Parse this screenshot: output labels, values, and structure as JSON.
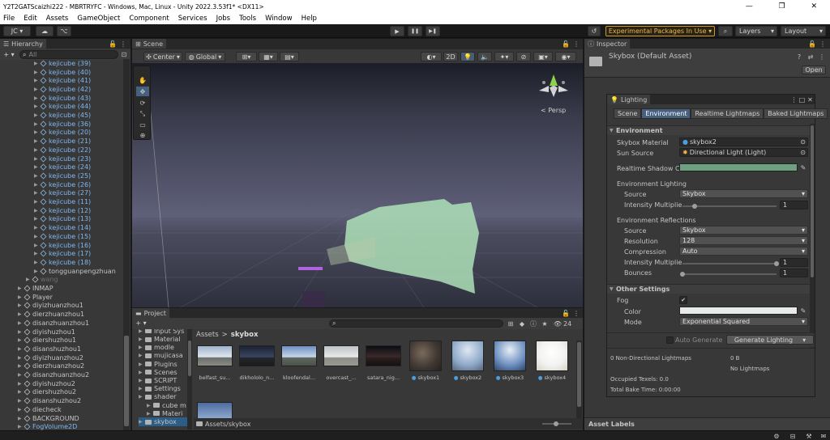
{
  "window": {
    "title": "Y2T2GATScaizhi222 - MBRTRYFC - Windows, Mac, Linux - Unity 2022.3.53f1* <DX11>",
    "minimize": "—",
    "maximize": "❐",
    "close": "✕"
  },
  "menu": [
    "File",
    "Edit",
    "Assets",
    "GameObject",
    "Component",
    "Services",
    "Jobs",
    "Tools",
    "Window",
    "Help"
  ],
  "toolbar": {
    "account": "JC ▾",
    "play": "▶",
    "pause": "❚❚",
    "step": "▶❚",
    "experimental": "Experimental Packages In Use ▾",
    "layers": "Layers",
    "layout": "Layout"
  },
  "hierarchy": {
    "tab": "Hierarchy",
    "search_placeholder": "All",
    "items": [
      {
        "label": "kejicube (39)",
        "indent": 52,
        "blue": true
      },
      {
        "label": "kejicube (40)",
        "indent": 52,
        "blue": true
      },
      {
        "label": "kejicube (41)",
        "indent": 52,
        "blue": true
      },
      {
        "label": "kejicube (42)",
        "indent": 52,
        "blue": true
      },
      {
        "label": "kejicube (43)",
        "indent": 52,
        "blue": true
      },
      {
        "label": "kejicube (44)",
        "indent": 52,
        "blue": true
      },
      {
        "label": "kejicube (45)",
        "indent": 52,
        "blue": true
      },
      {
        "label": "kejicube (36)",
        "indent": 52,
        "blue": true
      },
      {
        "label": "kejicube (20)",
        "indent": 52,
        "blue": true
      },
      {
        "label": "kejicube (21)",
        "indent": 52,
        "blue": true
      },
      {
        "label": "kejicube (22)",
        "indent": 52,
        "blue": true
      },
      {
        "label": "kejicube (23)",
        "indent": 52,
        "blue": true
      },
      {
        "label": "kejicube (24)",
        "indent": 52,
        "blue": true
      },
      {
        "label": "kejicube (25)",
        "indent": 52,
        "blue": true
      },
      {
        "label": "kejicube (26)",
        "indent": 52,
        "blue": true
      },
      {
        "label": "kejicube (27)",
        "indent": 52,
        "blue": true
      },
      {
        "label": "kejicube (11)",
        "indent": 52,
        "blue": true
      },
      {
        "label": "kejicube (12)",
        "indent": 52,
        "blue": true
      },
      {
        "label": "kejicube (13)",
        "indent": 52,
        "blue": true
      },
      {
        "label": "kejicube (14)",
        "indent": 52,
        "blue": true
      },
      {
        "label": "kejicube (15)",
        "indent": 52,
        "blue": true
      },
      {
        "label": "kejicube (16)",
        "indent": 52,
        "blue": true
      },
      {
        "label": "kejicube (17)",
        "indent": 52,
        "blue": true
      },
      {
        "label": "kejicube (18)",
        "indent": 52,
        "blue": true
      },
      {
        "label": "tongguanpengzhuan",
        "indent": 52,
        "blue": false
      },
      {
        "label": "wang",
        "indent": 42,
        "blue": false,
        "dim": true
      },
      {
        "label": "INMAP",
        "indent": 32,
        "blue": false
      },
      {
        "label": "Player",
        "indent": 32,
        "blue": false
      },
      {
        "label": "diyizhuanzhou1",
        "indent": 32,
        "blue": false
      },
      {
        "label": "dierzhuanzhou1",
        "indent": 32,
        "blue": false
      },
      {
        "label": "disanzhuanzhou1",
        "indent": 32,
        "blue": false
      },
      {
        "label": "diyishuzhou1",
        "indent": 32,
        "blue": false
      },
      {
        "label": "diershuzhou1",
        "indent": 32,
        "blue": false
      },
      {
        "label": "disanshuzhou1",
        "indent": 32,
        "blue": false
      },
      {
        "label": "diyizhuanzhou2",
        "indent": 32,
        "blue": false
      },
      {
        "label": "dierzhuanzhou2",
        "indent": 32,
        "blue": false
      },
      {
        "label": "disanzhuanzhou2",
        "indent": 32,
        "blue": false
      },
      {
        "label": "diyishuzhou2",
        "indent": 32,
        "blue": false
      },
      {
        "label": "diershuzhou2",
        "indent": 32,
        "blue": false
      },
      {
        "label": "disanshuzhou2",
        "indent": 32,
        "blue": false
      },
      {
        "label": "diecheck",
        "indent": 32,
        "blue": false
      },
      {
        "label": "BACKGROUND",
        "indent": 32,
        "blue": false
      },
      {
        "label": "FogVolume2D",
        "indent": 32,
        "blue": true
      }
    ]
  },
  "scene": {
    "tab": "Scene",
    "pivot": "Center",
    "space": "Global",
    "mode2d": "2D",
    "persp": "< Persp"
  },
  "project": {
    "tab": "Project",
    "search_placeholder": "",
    "count": "24",
    "breadcrumb_root": "Assets",
    "breadcrumb_sep": ">",
    "breadcrumb_current": "skybox",
    "footer_path": "Assets/skybox",
    "tree": [
      {
        "label": "Input Sys",
        "indent": 8
      },
      {
        "label": "Material",
        "indent": 8
      },
      {
        "label": "modle",
        "indent": 8
      },
      {
        "label": "mujicasa",
        "indent": 8
      },
      {
        "label": "Plugins",
        "indent": 8
      },
      {
        "label": "Scenes",
        "indent": 8
      },
      {
        "label": "SCRIPT",
        "indent": 8
      },
      {
        "label": "Settings",
        "indent": 8
      },
      {
        "label": "shader",
        "indent": 8
      },
      {
        "label": "cube m",
        "indent": 18
      },
      {
        "label": "Materi",
        "indent": 18
      },
      {
        "label": "skybox",
        "indent": 8
      }
    ],
    "assets": [
      {
        "name": "belfast_su...",
        "bg": "linear-gradient(#9fb3cc,#dfe6ee 55%,#6a6f6e 60%,#8a8a80)",
        "icon": false
      },
      {
        "name": "dikhololo_n...",
        "bg": "linear-gradient(#1c2233,#3a4660 55%,#22262c 60%,#1a1b1d)",
        "icon": false
      },
      {
        "name": "kloofendal...",
        "bg": "linear-gradient(#6e8fc0,#c7d6ea 55%,#5d6660 60%,#4b524a)",
        "icon": false
      },
      {
        "name": "overcast_...",
        "bg": "linear-gradient(#bfc3c7,#e8e9ea 55%,#8d8e87 60%,#9a9890)",
        "icon": false
      },
      {
        "name": "satara_nig...",
        "bg": "linear-gradient(#0d0d12,#3b2a2c 55%,#2b1f1c 60%,#141011)",
        "icon": false
      },
      {
        "name": "skybox1",
        "bg": "radial-gradient(circle at 40% 40%,#7a6a5c,#3e3631 60%,#272321)",
        "icon": true
      },
      {
        "name": "skybox2",
        "bg": "radial-gradient(circle at 50% 30%,#dfe8f4,#8fa9c9 60%,#56657a)",
        "icon": true
      },
      {
        "name": "skybox3",
        "bg": "radial-gradient(circle at 50% 30%,#e8eef6,#6d8fbf 60%,#2f4468)",
        "icon": true
      },
      {
        "name": "skybox4",
        "bg": "radial-gradient(circle at 50% 40%,#ffffff,#f2f2f0 55%,#d8d3c8)",
        "icon": true
      },
      {
        "name": "",
        "bg": "linear-gradient(#4d6d9e,#9cb6d8)",
        "icon": false
      }
    ]
  },
  "inspector": {
    "tab": "Inspector",
    "asset_title": "Skybox (Default Asset)",
    "open_label": "Open",
    "asset_labels": "Asset Labels"
  },
  "lighting": {
    "title": "Lighting",
    "tabs": [
      "Scene",
      "Environment",
      "Realtime Lightmaps",
      "Baked Lightmaps"
    ],
    "active_tab_index": 1,
    "environment_header": "Environment",
    "skybox_material_label": "Skybox Material",
    "skybox_material_value": "skybox2",
    "sun_source_label": "Sun Source",
    "sun_source_value": "Directional Light (Light)",
    "realtime_shadow_label": "Realtime Shadow C",
    "realtime_shadow_color": "#6da181",
    "env_lighting_header": "Environment Lighting",
    "env_source_label": "Source",
    "env_source_value": "Skybox",
    "env_intensity_label": "Intensity Multiplie",
    "env_intensity_value": "1",
    "env_intensity_fraction": 0.125,
    "env_reflections_header": "Environment Reflections",
    "refl_source_label": "Source",
    "refl_source_value": "Skybox",
    "refl_resolution_label": "Resolution",
    "refl_resolution_value": "128",
    "refl_compression_label": "Compression",
    "refl_compression_value": "Auto",
    "refl_intensity_label": "Intensity Multiplie",
    "refl_intensity_value": "1",
    "refl_intensity_fraction": 1.0,
    "bounces_label": "Bounces",
    "bounces_value": "1",
    "bounces_fraction": 0.0,
    "other_header": "Other Settings",
    "fog_label": "Fog",
    "fog_checked": "✔",
    "fog_color_label": "Color",
    "fog_color": "#e6ebea",
    "fog_mode_label": "Mode",
    "fog_mode_value": "Exponential Squared",
    "auto_generate_label": "Auto Generate",
    "generate_label": "Generate Lighting",
    "stats": {
      "non_directional_label": "0 Non-Directional Lightmaps",
      "non_directional_value": "0 B",
      "no_lightmaps": "No Lightmaps",
      "occupied": "Occupied Texels: 0.0",
      "bake_time": "Total Bake Time: 0:00:00"
    }
  }
}
